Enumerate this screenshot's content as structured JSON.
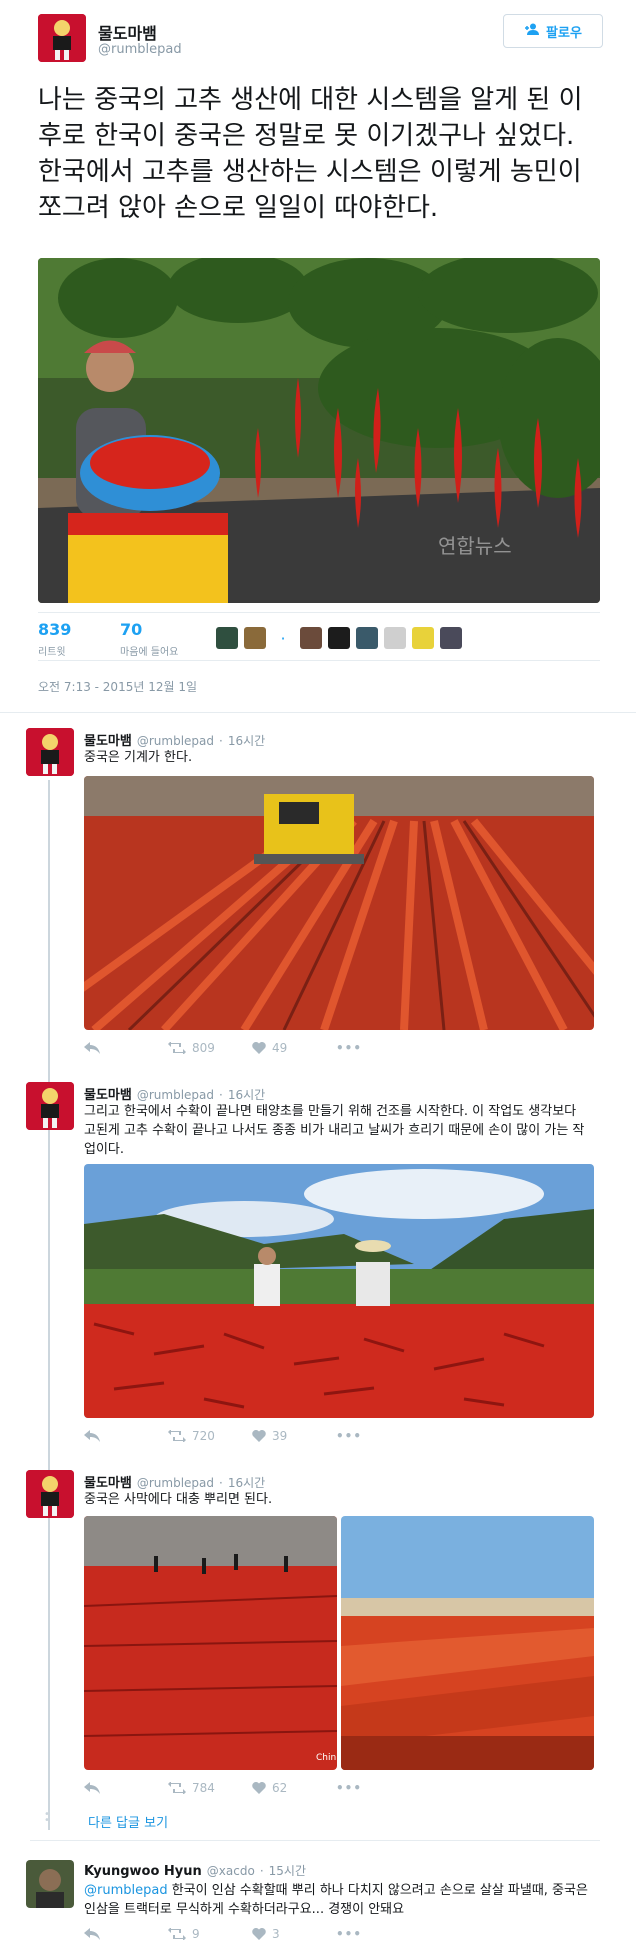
{
  "main_tweet": {
    "author_name": "물도마뱀",
    "author_handle": "@rumblepad",
    "follow_label": "팔로우",
    "text": "나는 중국의 고추 생산에 대한 시스템을 알게 된 이후로 한국이 중국은 정말로 못 이기겠구나 싶었다. 한국에서 고추를 생산하는 시스템은 이렇게 농민이 쪼그려 앉아 손으로 일일이 따야한다.",
    "watermark": "연합뉴스",
    "retweets": "839",
    "retweets_label": "리트윗",
    "likes": "70",
    "likes_label": "마음에 들어요",
    "timestamp": "오전 7:13 - 2015년 12월 1일"
  },
  "replies": [
    {
      "author_name": "물도마뱀",
      "author_handle": "@rumblepad",
      "time": "16시간",
      "text": "중국은 기계가 한다.",
      "retweets": "809",
      "likes": "49"
    },
    {
      "author_name": "물도마뱀",
      "author_handle": "@rumblepad",
      "time": "16시간",
      "text": "그리고 한국에서 수확이 끝나면 태양초를 만들기 위해 건조를 시작한다. 이 작업도 생각보다 고된게 고추 수확이 끝나고 나서도 종종 비가 내리고 날씨가 흐리기 때문에 손이 많이 가는 작업이다.",
      "retweets": "720",
      "likes": "39"
    },
    {
      "author_name": "물도마뱀",
      "author_handle": "@rumblepad",
      "time": "16시간",
      "text": "중국은 사막에다 대충 뿌리면 된다.",
      "photo_mark": "Chin",
      "retweets": "784",
      "likes": "62"
    }
  ],
  "more_replies_label": "다른 답글 보기",
  "last_reply": {
    "author_name": "Kyungwoo Hyun",
    "author_handle": "@xacdo",
    "time": "15시간",
    "mention": "@rumblepad",
    "text": " 한국이 인삼 수확할때 뿌리 하나 다치지 않으려고 손으로 살살 파낼때, 중국은 인삼을 트랙터로 무식하게 수확하더라구요... 경쟁이 안돼요",
    "retweets": "9",
    "likes": "3"
  },
  "colors": {
    "accent": "#1da1f2",
    "retweet_green": "#17bf63",
    "like_red": "#e0245e",
    "muted": "#8899a6"
  },
  "icons": [
    "follow-person-icon",
    "reply-icon",
    "retweet-icon",
    "heart-icon",
    "more-icon"
  ]
}
